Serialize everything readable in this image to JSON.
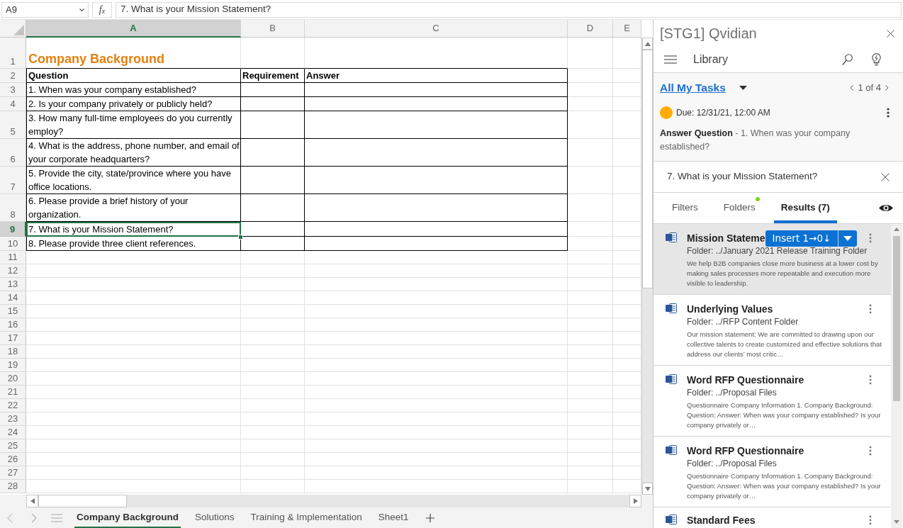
{
  "formula_bar": {
    "name_box": "A9",
    "function_label": "f$_{x}$",
    "formula": "7. What is your Mission Statement?"
  },
  "sheet": {
    "columns": [
      {
        "label": "A",
        "selected": true
      },
      {
        "label": "B",
        "selected": false
      },
      {
        "label": "C",
        "selected": false
      },
      {
        "label": "D",
        "selected": false
      },
      {
        "label": "E",
        "selected": false
      }
    ],
    "rows": [
      {
        "number": "1",
        "selected": false,
        "kind": "title",
        "text": "Company Background"
      },
      {
        "number": "2",
        "selected": false,
        "kind": "header",
        "cells": [
          "Question",
          "Requirement",
          "Answer"
        ]
      },
      {
        "number": "3",
        "selected": false,
        "kind": "question",
        "text": "1. When was your company established?"
      },
      {
        "number": "4",
        "selected": false,
        "kind": "question",
        "text": "2. Is your company privately or publicly held?"
      },
      {
        "number": "5",
        "selected": false,
        "kind": "question",
        "text": "3. How many full-time employees do you currently employ?"
      },
      {
        "number": "6",
        "selected": false,
        "kind": "question",
        "text": "4. What is the address, phone number, and email of your corporate headquarters?"
      },
      {
        "number": "7",
        "selected": false,
        "kind": "question",
        "text": "5. Provide the city, state/province where you have office locations."
      },
      {
        "number": "8",
        "selected": false,
        "kind": "question",
        "text": "6. Please provide a brief history of your organization."
      },
      {
        "number": "9",
        "selected": true,
        "kind": "question",
        "text": "7. What is your Mission Statement?"
      },
      {
        "number": "10",
        "selected": false,
        "kind": "question",
        "text": "8. Please provide three client references."
      },
      {
        "number": "11",
        "selected": false,
        "kind": "empty"
      },
      {
        "number": "12",
        "selected": false,
        "kind": "empty"
      },
      {
        "number": "13",
        "selected": false,
        "kind": "empty"
      },
      {
        "number": "14",
        "selected": false,
        "kind": "empty"
      },
      {
        "number": "15",
        "selected": false,
        "kind": "empty"
      },
      {
        "number": "16",
        "selected": false,
        "kind": "empty"
      },
      {
        "number": "17",
        "selected": false,
        "kind": "empty"
      },
      {
        "number": "18",
        "selected": false,
        "kind": "empty"
      },
      {
        "number": "19",
        "selected": false,
        "kind": "empty"
      },
      {
        "number": "20",
        "selected": false,
        "kind": "empty"
      },
      {
        "number": "21",
        "selected": false,
        "kind": "empty"
      },
      {
        "number": "22",
        "selected": false,
        "kind": "empty"
      },
      {
        "number": "23",
        "selected": false,
        "kind": "empty"
      },
      {
        "number": "24",
        "selected": false,
        "kind": "empty"
      },
      {
        "number": "25",
        "selected": false,
        "kind": "empty"
      },
      {
        "number": "26",
        "selected": false,
        "kind": "empty"
      },
      {
        "number": "27",
        "selected": false,
        "kind": "empty"
      },
      {
        "number": "28",
        "selected": false,
        "kind": "empty"
      }
    ]
  },
  "sheet_tabs": [
    {
      "label": "Company Background",
      "selected": true
    },
    {
      "label": "Solutions",
      "selected": false
    },
    {
      "label": "Training & Implementation",
      "selected": false
    },
    {
      "label": "Sheet1",
      "selected": false
    }
  ],
  "panel": {
    "title": "[STG1] Qvidian",
    "nav_title": "Library",
    "tasks": {
      "filter": "All My Tasks",
      "pager": "1 of 4",
      "due": "Due: 12/31/21, 12:00 AM",
      "description": "**Answer Question** - 1. When was your company established?"
    },
    "query": "7. What is your Mission Statement?",
    "tabs": [
      {
        "label": "Filters",
        "selected": false,
        "indicator": false
      },
      {
        "label": "Folders",
        "selected": false,
        "indicator": true
      },
      {
        "label": "Results (7)",
        "selected": true,
        "indicator": false
      }
    ],
    "results": [
      {
        "title": "Mission Stateme",
        "action": "Insert 1→0↓",
        "folder": "Folder: ../January 2021 Release Training Folder",
        "snippet": "We help B2B companies close more business at a lower cost by making sales processes more repeatable and execution more visible to leadership.",
        "selected": true
      },
      {
        "title": "Underlying Values",
        "folder": "Folder: ../RFP Content Folder",
        "snippet": "Our mission statement: We are committed to drawing upon our collective talents to create customized and effective solutions that address our clients’ most critic…",
        "selected": false
      },
      {
        "title": "Word RFP Questionnaire",
        "folder": "Folder: ../Proposal Files",
        "snippet": "Questionnaire Company Information 1. Company Background: Question: Answer: When was your company established? Is your company privately or…",
        "selected": false
      },
      {
        "title": "Word RFP Questionnaire",
        "folder": "Folder: ../Proposal Files",
        "snippet": "Questionnaire Company Information 1. Company Background: Question: Answer: When was your company established? Is your company privately or…",
        "selected": false
      },
      {
        "title": "Standard Fees",
        "selected": false
      }
    ]
  }
}
